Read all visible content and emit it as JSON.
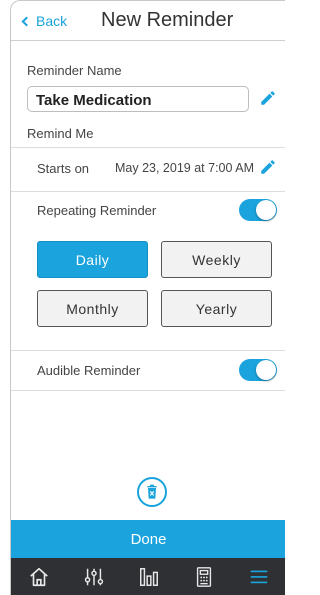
{
  "header": {
    "back_label": "Back",
    "title": "New Reminder"
  },
  "form": {
    "name_label": "Reminder Name",
    "name_value": "Take Medication",
    "remind_me_label": "Remind Me",
    "starts_on_label": "Starts on",
    "starts_on_value": "May 23, 2019 at  7:00 AM",
    "repeating_label": "Repeating Reminder",
    "repeating_on": true,
    "frequency_options": [
      "Daily",
      "Weekly",
      "Monthly",
      "Yearly"
    ],
    "frequency_selected": "Daily",
    "audible_label": "Audible Reminder",
    "audible_on": true
  },
  "actions": {
    "done_label": "Done"
  },
  "tabbar": {
    "items": [
      "home-icon",
      "sliders-icon",
      "bar-chart-icon",
      "calculator-icon",
      "menu-icon"
    ],
    "active": "menu-icon"
  },
  "colors": {
    "accent": "#1aa3dc",
    "tabbar_bg": "#2f3033"
  }
}
